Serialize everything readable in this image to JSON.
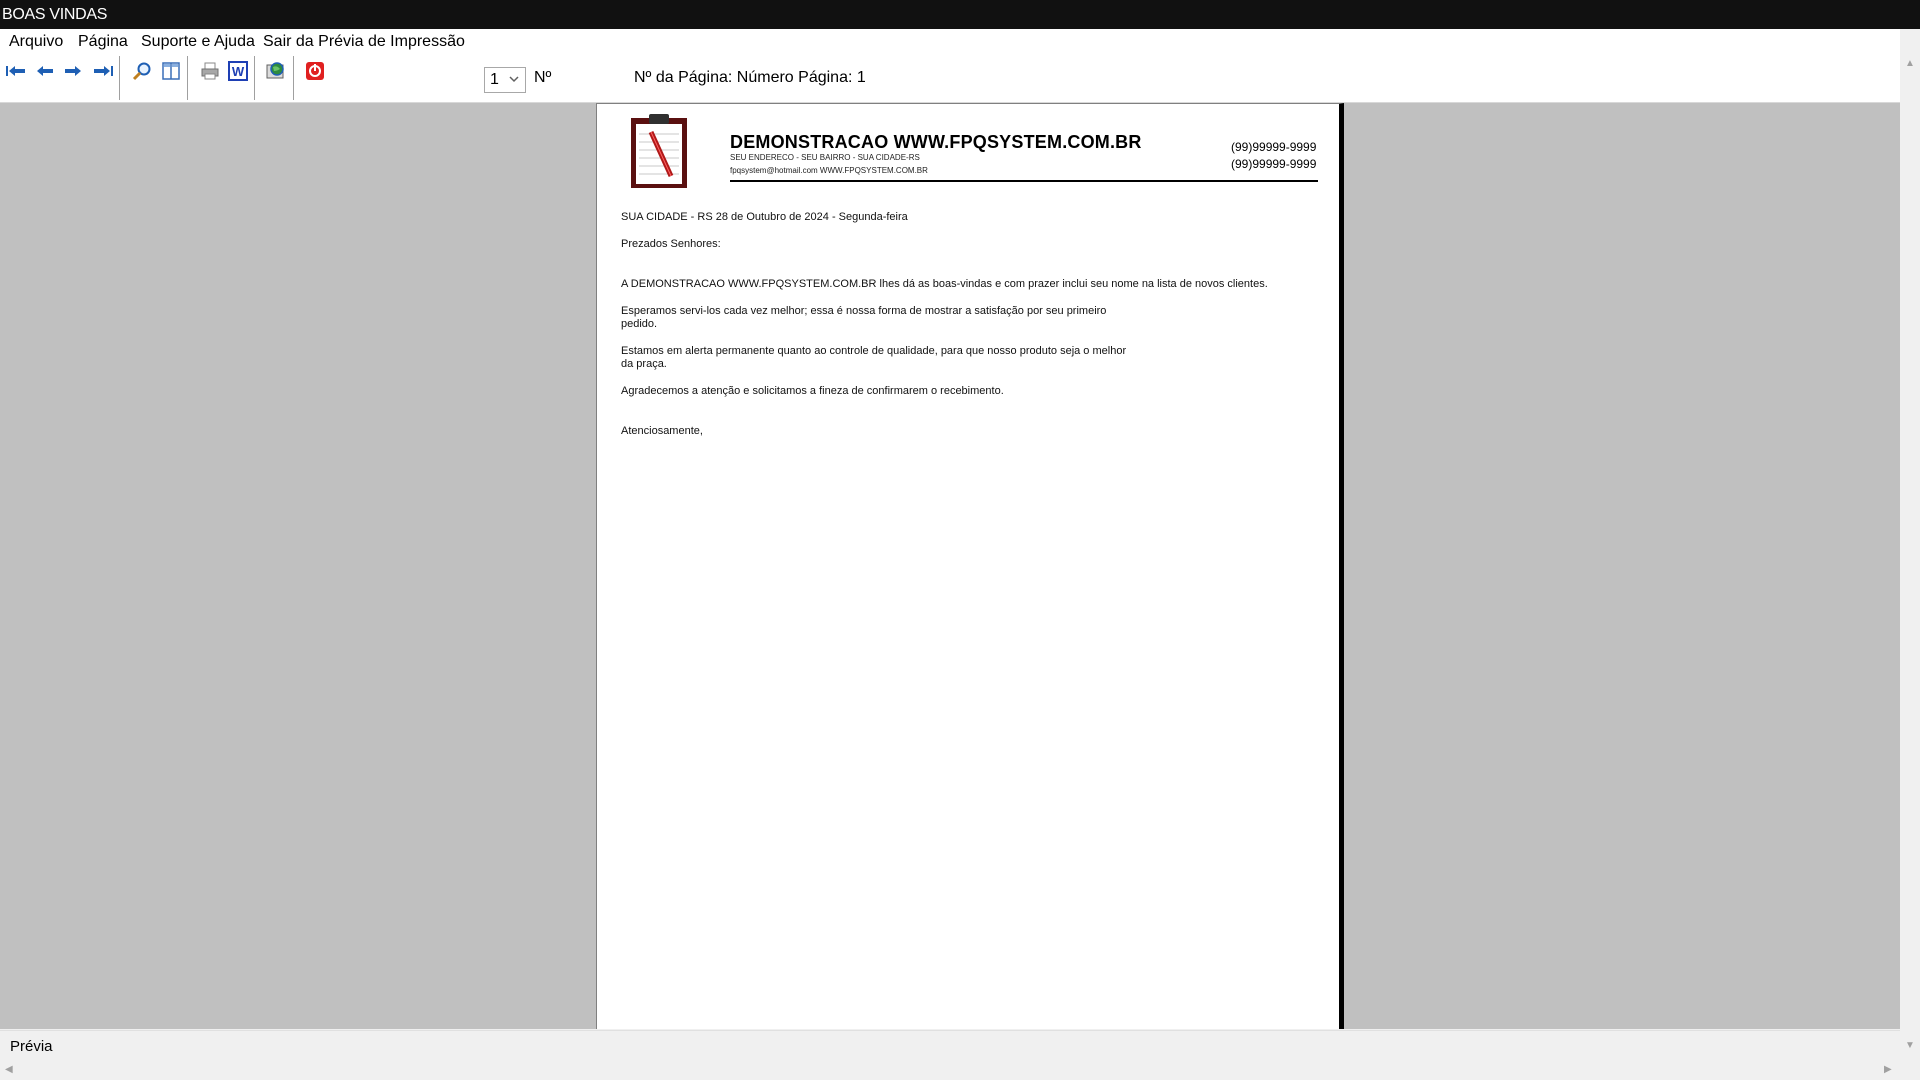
{
  "window": {
    "title": "BOAS VINDAS"
  },
  "menu": {
    "items": [
      "Arquivo",
      "Página",
      "Suporte e Ajuda",
      "Sair da Prévia de Impressão"
    ]
  },
  "toolbar": {
    "page_select_value": "1",
    "n_label": "Nº",
    "page_info": "Nº da Página: Número Página: 1",
    "icons": [
      "first-page-icon",
      "prev-page-icon",
      "next-page-icon",
      "last-page-icon",
      "zoom-icon",
      "page-layout-icon",
      "print-icon",
      "word-export-icon",
      "web-export-icon",
      "close-preview-icon"
    ]
  },
  "document": {
    "company": "DEMONSTRACAO WWW.FPQSYSTEM.COM.BR",
    "address": "SEU ENDERECO - SEU BAIRRO - SUA CIDADE-RS",
    "email_site": "fpqsystem@hotmail.com  WWW.FPQSYSTEM.COM.BR",
    "phone1": "(99)99999-9999",
    "phone2": "(99)99999-9999",
    "lines": [
      "SUA CIDADE - RS 28 de Outubro de 2024 - Segunda-feira",
      "Prezados Senhores:",
      "A DEMONSTRACAO WWW.FPQSYSTEM.COM.BR lhes dá as boas-vindas e com prazer inclui seu nome na lista de novos clientes.",
      "Esperamos servi-los cada vez melhor; essa é nossa forma de mostrar a satisfação por seu primeiro",
      "pedido.",
      "Estamos em alerta permanente quanto ao controle de qualidade, para que nosso produto seja o melhor",
      "da praça.",
      "Agradecemos a atenção e solicitamos a fineza de confirmarem o recebimento.",
      "Atenciosamente,"
    ]
  },
  "status": {
    "text": "Prévia"
  },
  "colors": {
    "titlebar": "#111111",
    "workspace": "#c0c0c0",
    "nav_arrow_blue": "#1e5fb4",
    "close_red": "#e02020"
  }
}
